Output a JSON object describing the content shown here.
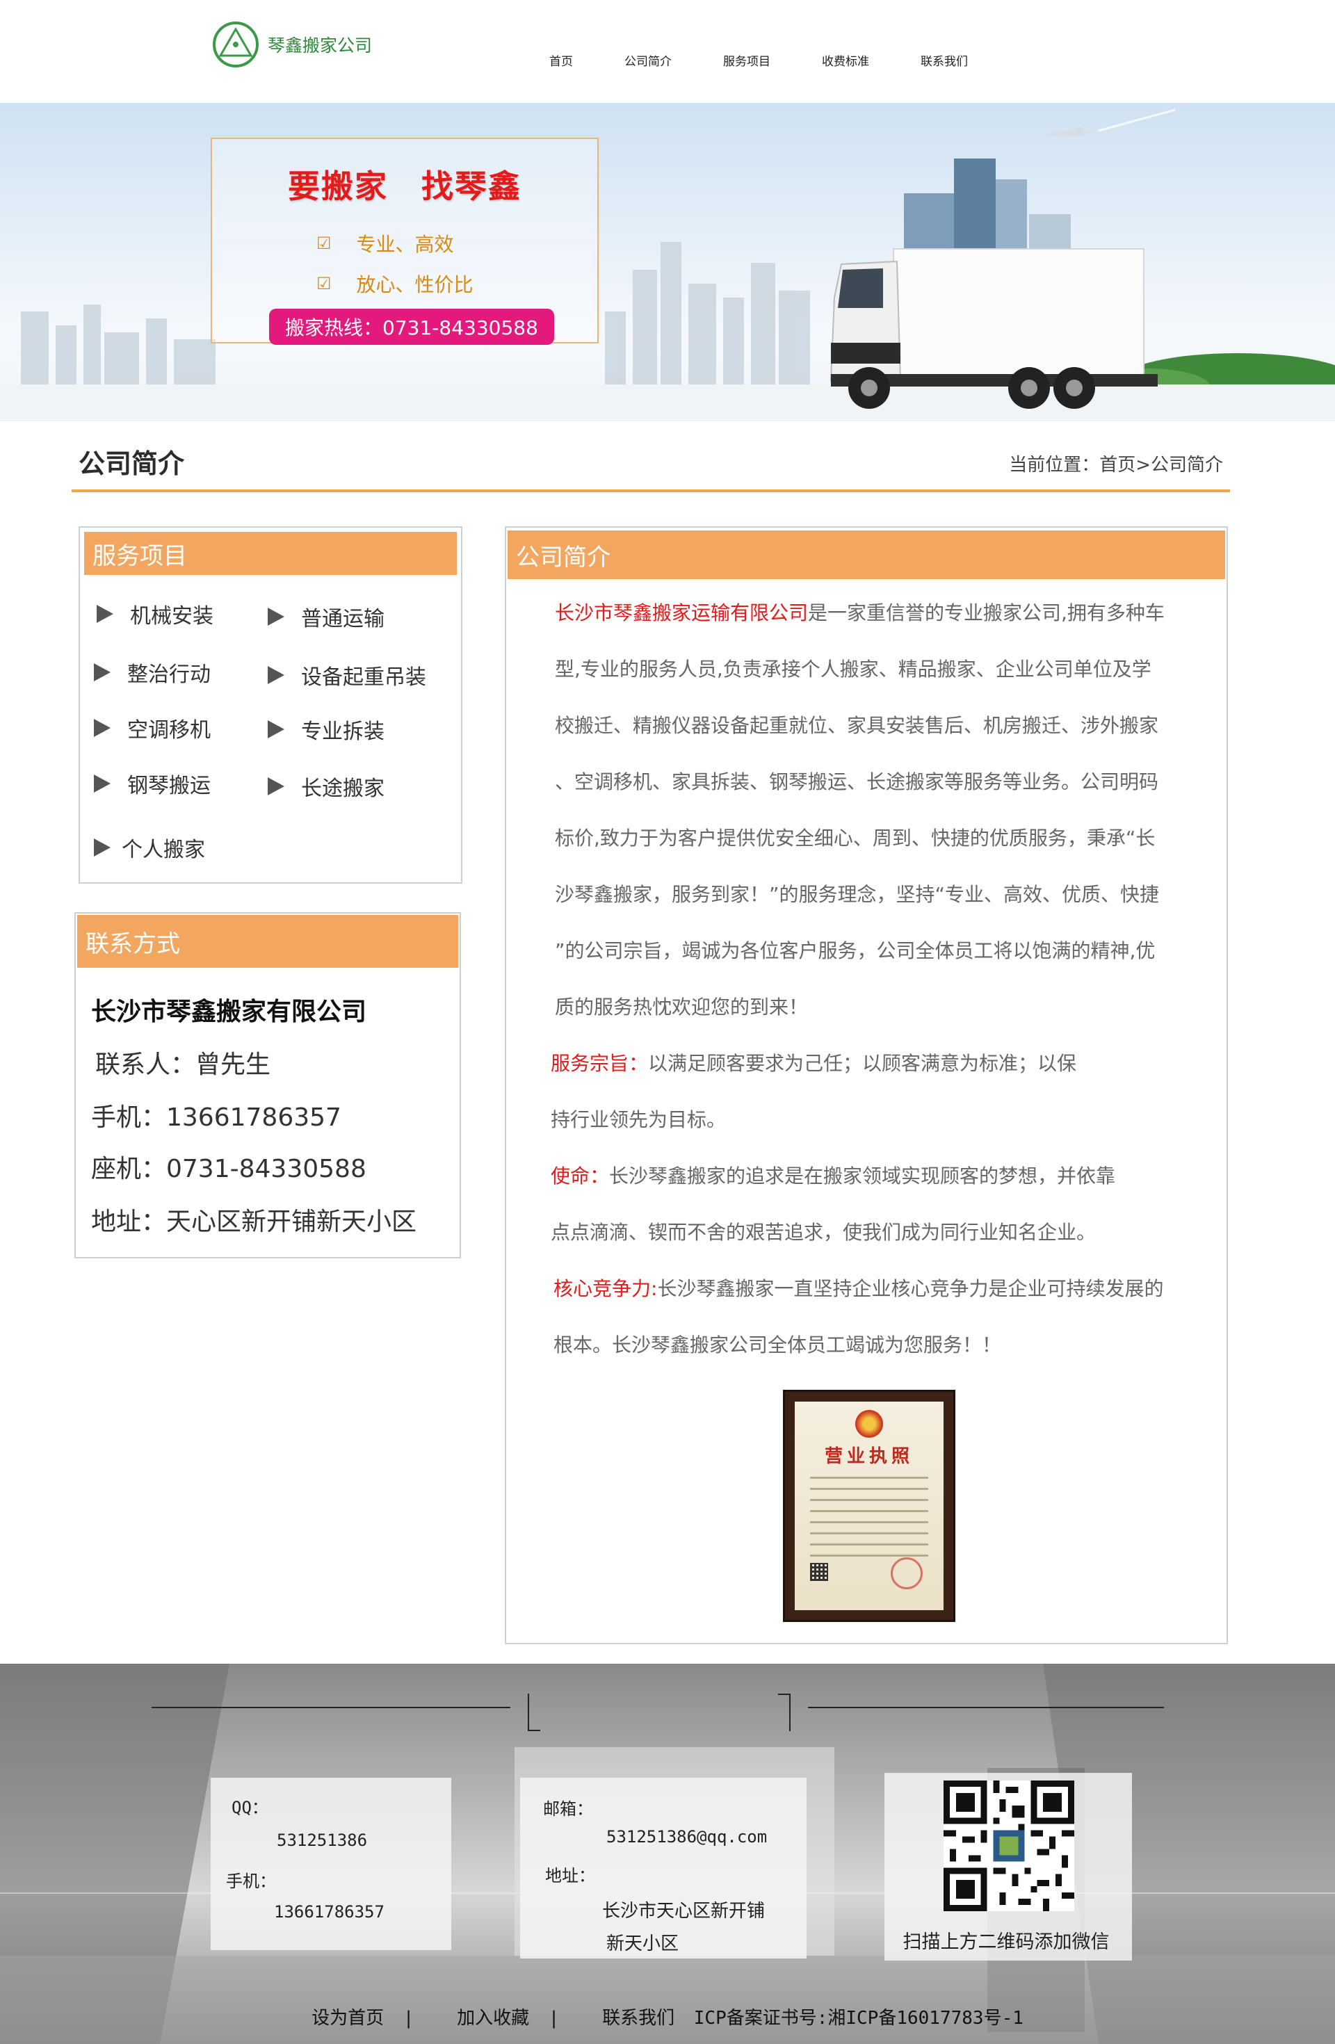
{
  "header": {
    "logo_text": "琴鑫搬家公司",
    "nav": [
      "首页",
      "公司简介",
      "服务项目",
      "收费标准",
      "联系我们"
    ]
  },
  "banner": {
    "slogan": "要搬家　找琴鑫",
    "feature_1": "专业、高效",
    "feature_2": "放心、性价比",
    "hotline": "搬家热线：0731-84330588"
  },
  "page": {
    "title": "公司简介",
    "breadcrumb": "当前位置：首页>公司简介"
  },
  "services": {
    "title": "服务项目",
    "items": [
      "机械安装",
      "普通运输",
      "整治行动",
      "设备起重吊装",
      "空调移机",
      "专业拆装",
      "钢琴搬运",
      "长途搬家",
      "个人搬家"
    ]
  },
  "contact": {
    "title": "联系方式",
    "company": "长沙市琴鑫搬家有限公司",
    "person": "联系人：曾先生",
    "mobile": "手机：13661786357",
    "phone": "座机：0731-84330588",
    "address": "地址：天心区新开铺新天小区"
  },
  "intro": {
    "title": "公司简介",
    "company_name": "长沙市琴鑫搬家运输有限公司",
    "lines": [
      "是一家重信誉的专业搬家公司,拥有多种车",
      "型,专业的服务人员,负责承接个人搬家、精品搬家、企业公司单位及学",
      "校搬迁、精搬仪器设备起重就位、家具安装售后、机房搬迁、涉外搬家",
      "、空调移机、家具拆装、钢琴搬运、长途搬家等服务等业务。公司明码",
      "标价,致力于为客户提供优安全细心、周到、快捷的优质服务，秉承“长",
      "沙琴鑫搬家，服务到家！”的服务理念，坚持“专业、高效、优质、快捷",
      "”的公司宗旨，竭诚为各位客户服务，公司全体员工将以饱满的精神,优",
      "质的服务热忱欢迎您的到来！"
    ],
    "purpose_label": "服务宗旨：",
    "purpose_1": "以满足顾客要求为己任；以顾客满意为标准；以保",
    "purpose_2": "持行业领先为目标。",
    "mission_label": "使命：",
    "mission_1": "长沙琴鑫搬家的追求是在搬家领域实现顾客的梦想，并依靠",
    "mission_2": "点点滴滴、锲而不舍的艰苦追求，使我们成为同行业知名企业。",
    "core_label": "核心竞争力:",
    "core_1": "长沙琴鑫搬家一直坚持企业核心竞争力是企业可持续发展的",
    "core_2": "根本。长沙琴鑫搬家公司全体员工竭诚为您服务！！",
    "license_title": "营业执照"
  },
  "footer": {
    "qq_label": "QQ：",
    "qq_value": "531251386",
    "mobile_label": "手机：",
    "mobile_value": "13661786357",
    "email_label": "邮箱：",
    "email_value": "531251386@qq.com",
    "address_label": "地址：",
    "address_1": "长沙市天心区新开铺",
    "address_2": "新天小区",
    "qr_caption": "扫描上方二维码添加微信",
    "link_home": "设为首页",
    "link_fav": "加入收藏",
    "link_contact": "联系我们",
    "icp": "ICP备案证书号:湘ICP备16017783号-1",
    "sep": "|"
  },
  "colors": {
    "accent_orange": "#f3a660",
    "title_red": "#e41b1b",
    "hotline_pink": "#e4197d",
    "logo_green": "#2e8a3a"
  }
}
